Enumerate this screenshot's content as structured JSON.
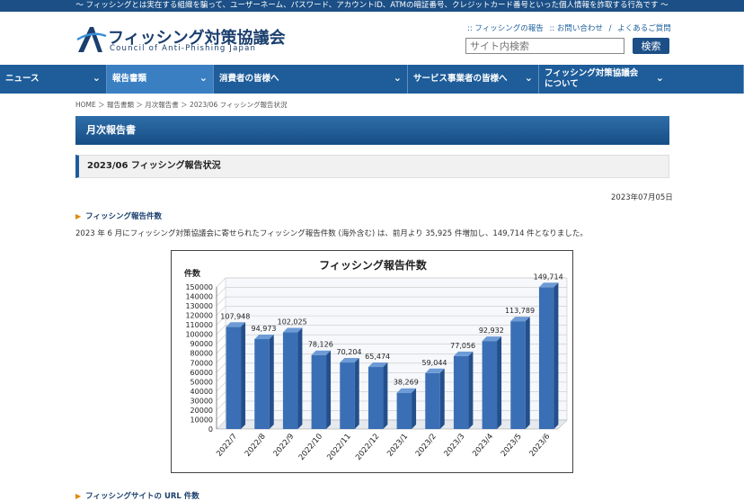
{
  "top_banner": "～ フィッシングとは実在する組織を騙って、ユーザーネーム、パスワード、アカウントID、ATMの暗証番号、クレジットカード番号といった個人情報を詐取する行為です ～",
  "logo": {
    "name": "フィッシング対策協議会",
    "sub": "Council of Anti-Phishing Japan"
  },
  "header_links": [
    ":: フィッシングの報告",
    ":: お問い合わせ",
    "/",
    "よくあるご質問"
  ],
  "search": {
    "placeholder": "サイト内検索",
    "button": "検索"
  },
  "nav": [
    {
      "label": "ニュース",
      "label2": ""
    },
    {
      "label": "報告書類",
      "label2": ""
    },
    {
      "label": "消費者の皆様へ",
      "label2": ""
    },
    {
      "label": "サービス事業者の皆様へ",
      "label2": ""
    },
    {
      "label": "フィッシング対策協議会",
      "label2": "について"
    }
  ],
  "breadcrumb": "HOME ＞ 報告書類 ＞ 月次報告書 ＞ 2023/06 フィッシング報告状況",
  "page_title": "月次報告書",
  "subtitle": "2023/06 フィッシング報告状況",
  "date": "2023年07月05日",
  "section1": {
    "heading": "フィッシング報告件数",
    "text": "2023 年 6 月にフィッシング対策協議会に寄せられたフィッシング報告件数 (海外含む) は、前月より 35,925 件増加し、149,714 件となりました。"
  },
  "section2": {
    "heading": "フィッシングサイトの URL 件数"
  },
  "accent": "#1e5d9a",
  "chart_data": {
    "type": "bar",
    "title": "フィッシング報告件数",
    "ylabel": "件数",
    "xlabel": "",
    "categories": [
      "2022/7",
      "2022/8",
      "2022/9",
      "2022/10",
      "2022/11",
      "2022/12",
      "2023/1",
      "2023/2",
      "2023/3",
      "2023/4",
      "2023/5",
      "2023/6"
    ],
    "values": [
      107948,
      94973,
      102025,
      78126,
      70204,
      65474,
      38269,
      59044,
      77056,
      92932,
      113789,
      149714
    ],
    "value_labels": [
      "107,948",
      "94,973",
      "102,025",
      "78,126",
      "70,204",
      "65,474",
      "38,269",
      "59,044",
      "77,056",
      "92,932",
      "113,789",
      "149,714"
    ],
    "ylim": [
      0,
      150000
    ],
    "yticks": [
      "0",
      "10000",
      "20000",
      "30000",
      "40000",
      "50000",
      "60000",
      "70000",
      "80000",
      "90000",
      "100000",
      "110000",
      "120000",
      "130000",
      "140000",
      "150000"
    ],
    "grid": true,
    "bar_color": "#3a6fb5"
  }
}
